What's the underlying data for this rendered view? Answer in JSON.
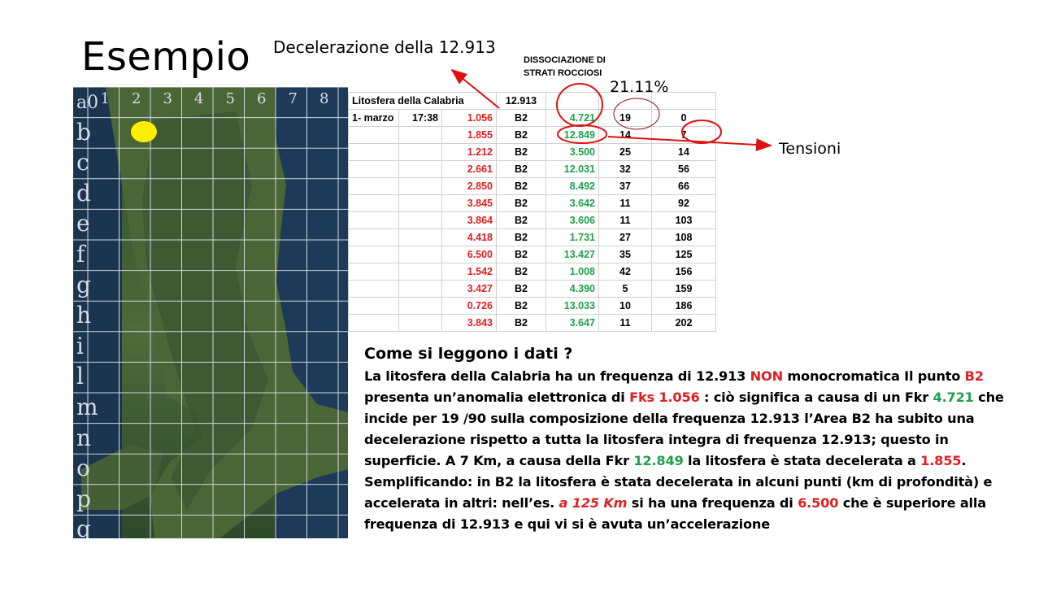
{
  "slide": {
    "title": "Esempio",
    "deceleration_label": "Decelerazione della 12.913",
    "dissociation_label_1": "DISSOCIAZIONE DI",
    "dissociation_label_2": "STRATI ROCCIOSI",
    "percent": "21.11%",
    "tension_label": "Tensioni"
  },
  "map": {
    "column_numbers": [
      "1",
      "2",
      "3",
      "4",
      "5",
      "6",
      "7",
      "8"
    ],
    "corner_label": "a0",
    "row_letters": [
      "b",
      "c",
      "d",
      "e",
      "f",
      "g",
      "h",
      "i",
      "l",
      "m",
      "n",
      "o",
      "p",
      "q"
    ],
    "marker_color": "#ffee00"
  },
  "table": {
    "header": {
      "region": "Litosfera della Calabria",
      "frequency": "12.913"
    },
    "first_row": {
      "date": "1- marzo",
      "time": "17:38"
    },
    "rows": [
      {
        "fks": "1.056",
        "point": "B2",
        "fkr": "4.721",
        "share": "19",
        "depth": "0"
      },
      {
        "fks": "1.855",
        "point": "B2",
        "fkr": "12.849",
        "share": "14",
        "depth": "7"
      },
      {
        "fks": "1.212",
        "point": "B2",
        "fkr": "3.500",
        "share": "25",
        "depth": "14"
      },
      {
        "fks": "2.661",
        "point": "B2",
        "fkr": "12.031",
        "share": "32",
        "depth": "56"
      },
      {
        "fks": "2.850",
        "point": "B2",
        "fkr": "8.492",
        "share": "37",
        "depth": "66"
      },
      {
        "fks": "3.845",
        "point": "B2",
        "fkr": "3.642",
        "share": "11",
        "depth": "92"
      },
      {
        "fks": "3.864",
        "point": "B2",
        "fkr": "3.606",
        "share": "11",
        "depth": "103"
      },
      {
        "fks": "4.418",
        "point": "B2",
        "fkr": "1.731",
        "share": "27",
        "depth": "108"
      },
      {
        "fks": "6.500",
        "point": "B2",
        "fkr": "13.427",
        "share": "35",
        "depth": "125"
      },
      {
        "fks": "1.542",
        "point": "B2",
        "fkr": "1.008",
        "share": "42",
        "depth": "156"
      },
      {
        "fks": "3.427",
        "point": "B2",
        "fkr": "4.390",
        "share": "5",
        "depth": "159"
      },
      {
        "fks": "0.726",
        "point": "B2",
        "fkr": "13.033",
        "share": "10",
        "depth": "186"
      },
      {
        "fks": "3.843",
        "point": "B2",
        "fkr": "3.647",
        "share": "11",
        "depth": "202"
      }
    ]
  },
  "explanation": {
    "question": "Come si leggono i dati ?",
    "l1a": "La litosfera della Calabria ha un frequenza di 12.913 ",
    "l1b": "NON",
    "l1c": " monocromatica  Il punto ",
    "l1d": "B2",
    "l2a": "presenta un’anomalia elettronica di ",
    "l2b": "Fks 1.056",
    "l2c": " : ciò significa a causa di un Fkr ",
    "l2d": "4.721",
    "l2e": " che",
    "l3": "incide per 19 /90 sulla composizione della frequenza 12.913  l’Area B2 ha subito una",
    "l4": "decelerazione rispetto a tutta la litosfera integra di frequenza 12.913; questo in",
    "l5a": "superficie. A 7 Km, a causa della Fkr ",
    "l5b": "12.849",
    "l5c": " la litosfera è stata decelerata a ",
    "l5d": "1.855",
    "l5e": ".",
    "l6": "Semplificando: in B2 la litosfera è stata decelerata in alcuni punti (km di profondità) e",
    "l7a": "accelerata in altri: nell’es. ",
    "l7b": "a 125 Km",
    "l7c": " si  ha una frequenza di ",
    "l7d": "6.500",
    "l7e": " che è superiore alla",
    "l8": "frequenza di 12.913 e qui vi si è avuta un’accelerazione"
  },
  "colors": {
    "red": "#e02020",
    "green": "#1fa04a",
    "annotation": "#e01010"
  }
}
